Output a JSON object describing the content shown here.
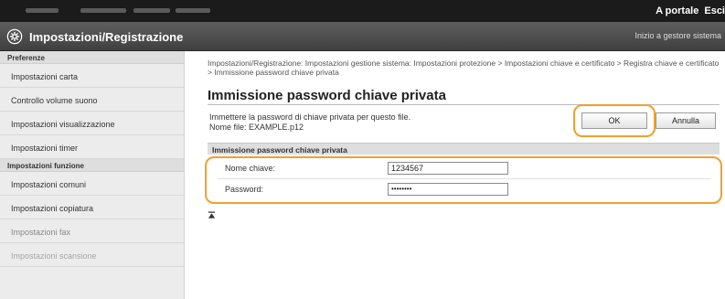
{
  "topbar": {
    "links": [
      "A portale",
      "Esci"
    ]
  },
  "header": {
    "title": "Impostazioni/Registrazione",
    "home_link": "Inizio a gestore sistema",
    "icon": "gear-icon"
  },
  "sidebar": {
    "section1": "Preferenze",
    "items1": [
      "Impostazioni carta",
      "Controllo volume suono",
      "Impostazioni visualizzazione",
      "Impostazioni timer"
    ],
    "section2": "Impostazioni funzione",
    "items2": [
      "Impostazioni comuni",
      "Impostazioni copiatura",
      "Impostazioni fax",
      "Impostazioni scansione"
    ]
  },
  "main": {
    "breadcrumb": "Impostazioni/Registrazione: Impostazioni gestione sistema: Impostazioni protezione > Impostazioni chiave e certificato > Registra chiave e certificato > Immissione password chiave privata",
    "title": "Immissione password chiave privata",
    "description_line1": "Immettere la password di chiave privata per questo file.",
    "description_line2": "Nome file: EXAMPLE.p12",
    "ok_label": "OK",
    "cancel_label": "Annulla",
    "section_title": "Immissione password chiave privata",
    "key_name_label": "Nome chiave:",
    "key_name_value": "1234567",
    "password_label": "Password:",
    "password_mask": "••••••••"
  },
  "colors": {
    "highlight": "#f0a030",
    "header": "#4a4a4a",
    "topbar": "#1b1b1b"
  }
}
